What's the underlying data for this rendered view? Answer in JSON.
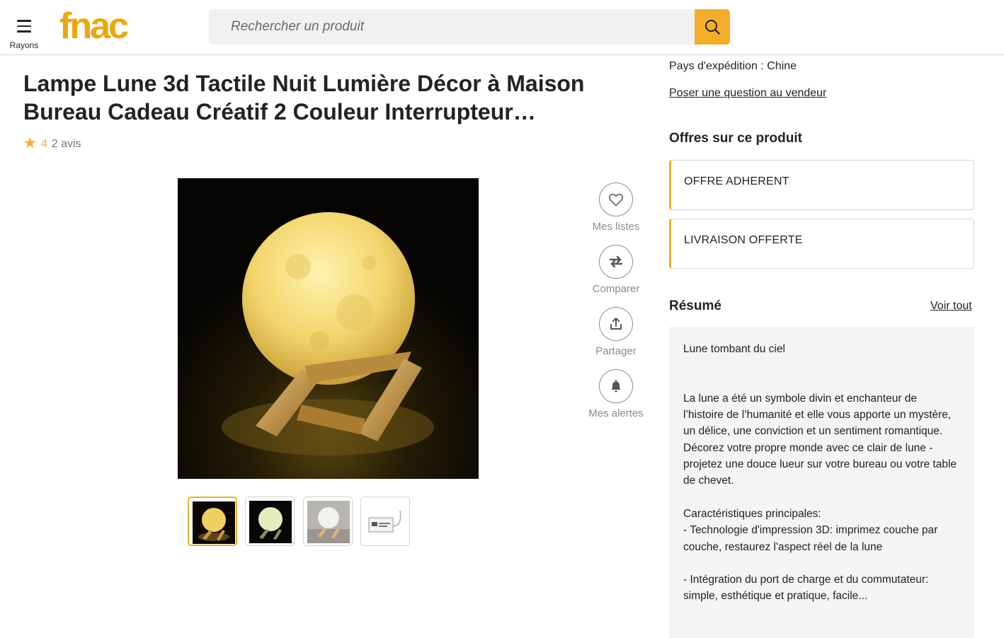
{
  "header": {
    "menu_label": "Rayons",
    "logo_text": "fnac",
    "search_placeholder": "Rechercher un produit"
  },
  "product": {
    "title": "Lampe Lune 3d Tactile Nuit Lumière Décor à Maison Bureau Cadeau Créatif 2 Couleur Interrupteur…",
    "rating_value": "4",
    "reviews": "2 avis",
    "selected_thumbnail": 1,
    "thumbnail_count": 4
  },
  "actions": [
    {
      "label": "Mes listes",
      "icon": "heart-icon"
    },
    {
      "label": "Comparer",
      "icon": "compare-arrows-icon"
    },
    {
      "label": "Partager",
      "icon": "share-icon"
    },
    {
      "label": "Mes alertes",
      "icon": "bell-icon"
    }
  ],
  "seller": {
    "shipping_country": "Pays d'expédition : Chine",
    "ask_question": "Poser une question au vendeur"
  },
  "offers": {
    "title": "Offres sur ce produit",
    "items": [
      "OFFRE ADHERENT",
      "LIVRAISON OFFERTE"
    ]
  },
  "resume": {
    "title": "Résumé",
    "voir_tout": "Voir tout",
    "text": "Lune tombant du ciel\n\n\nLa lune a été un symbole divin et enchanteur de l’histoire de l’humanité et elle vous apporte un mystère, un délice, une conviction et un sentiment romantique.\nDécorez votre propre monde avec ce clair de lune - projetez une douce lueur sur votre bureau ou votre table de chevet.\n\nCaractéristiques principales:\n- Technologie d'impression 3D: imprimez couche par couche, restaurez l'aspect réel de la lune\n\n- Intégration du port de charge et du commutateur: simple, esthétique et pratique, facile..."
  },
  "colors": {
    "accent": "#f3ad2a",
    "text": "#232323",
    "muted": "#8a8a8a",
    "panel": "#f4f4f4"
  }
}
